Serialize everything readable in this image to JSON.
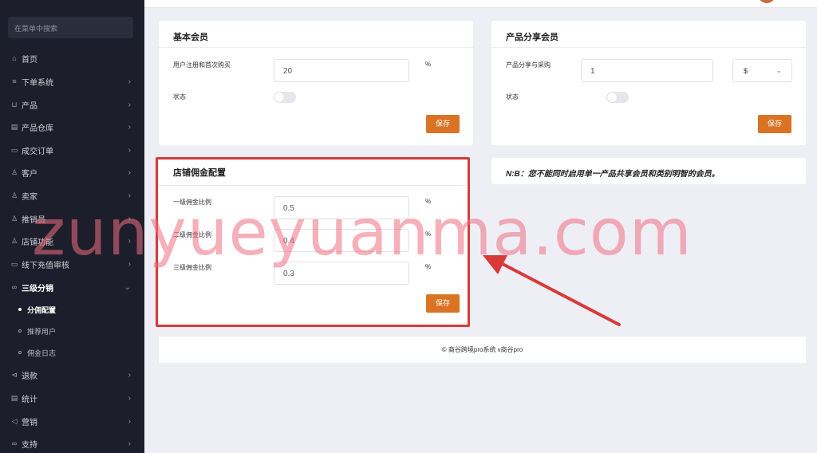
{
  "sidebar": {
    "search_placeholder": "在菜单中搜索",
    "items": [
      {
        "icon": "home-icon",
        "glyph": "⌂",
        "label": "首页",
        "has_chevron": false
      },
      {
        "icon": "list-icon",
        "glyph": "≡",
        "label": "下单系统",
        "has_chevron": true
      },
      {
        "icon": "cart-icon",
        "glyph": "⊔",
        "label": "产品",
        "has_chevron": true
      },
      {
        "icon": "warehouse-icon",
        "glyph": "▤",
        "label": "产品仓库",
        "has_chevron": true
      },
      {
        "icon": "order-icon",
        "glyph": "▭",
        "label": "成交订单",
        "has_chevron": true
      },
      {
        "icon": "users-icon",
        "glyph": "♙",
        "label": "客户",
        "has_chevron": true
      },
      {
        "icon": "seller-icon",
        "glyph": "♙",
        "label": "卖家",
        "has_chevron": true
      },
      {
        "icon": "promoter-icon",
        "glyph": "♙",
        "label": "推销员",
        "has_chevron": true
      },
      {
        "icon": "store-icon",
        "glyph": "♙",
        "label": "店铺功能",
        "has_chevron": true
      },
      {
        "icon": "recharge-icon",
        "glyph": "▭",
        "label": "线下充值审核",
        "has_chevron": true
      },
      {
        "icon": "link-icon",
        "glyph": "∞",
        "label": "三级分销",
        "has_chevron": true,
        "expanded": true
      }
    ],
    "sub_items": [
      {
        "label": "分佣配置",
        "active": true
      },
      {
        "label": "推荐用户",
        "active": false
      },
      {
        "label": "佣金日志",
        "active": false
      }
    ],
    "items_after": [
      {
        "icon": "refund-icon",
        "glyph": "⊲",
        "label": "退款",
        "has_chevron": true
      },
      {
        "icon": "stats-icon",
        "glyph": "▤",
        "label": "统计",
        "has_chevron": true
      },
      {
        "icon": "marketing-icon",
        "glyph": "◁",
        "label": "营销",
        "has_chevron": true
      },
      {
        "icon": "support-icon",
        "glyph": "∞",
        "label": "支持",
        "has_chevron": true
      }
    ]
  },
  "basic_member": {
    "title": "基本会员",
    "field_label": "用户注册和首次购买",
    "field_value": "20",
    "unit": "%",
    "status_label": "状态",
    "status_on": false,
    "save_label": "保存"
  },
  "product_share": {
    "title": "产品分享会员",
    "field_label": "产品分享与采购",
    "field_value": "1",
    "currency": "$",
    "status_label": "状态",
    "status_on": false,
    "save_label": "保存"
  },
  "store_commission": {
    "title": "店铺佣金配置",
    "levels": [
      {
        "label": "一级佣金比例",
        "value": "0.5",
        "unit": "%"
      },
      {
        "label": "二级佣金比例",
        "value": "0.4",
        "unit": "%"
      },
      {
        "label": "三级佣金比例",
        "value": "0.3",
        "unit": "%"
      }
    ],
    "save_label": "保存"
  },
  "notice": "N:B：您不能同时启用单一产品共享会员和类别明智的会员。",
  "footer": "© 商谷跨境pro系统 v商谷pro",
  "watermark": "zunyueyuanma.com",
  "colors": {
    "sidebar_bg": "#1c1f2b",
    "accent": "#db7325",
    "highlight": "#d83a3a",
    "arrow": "#d83a3a"
  }
}
